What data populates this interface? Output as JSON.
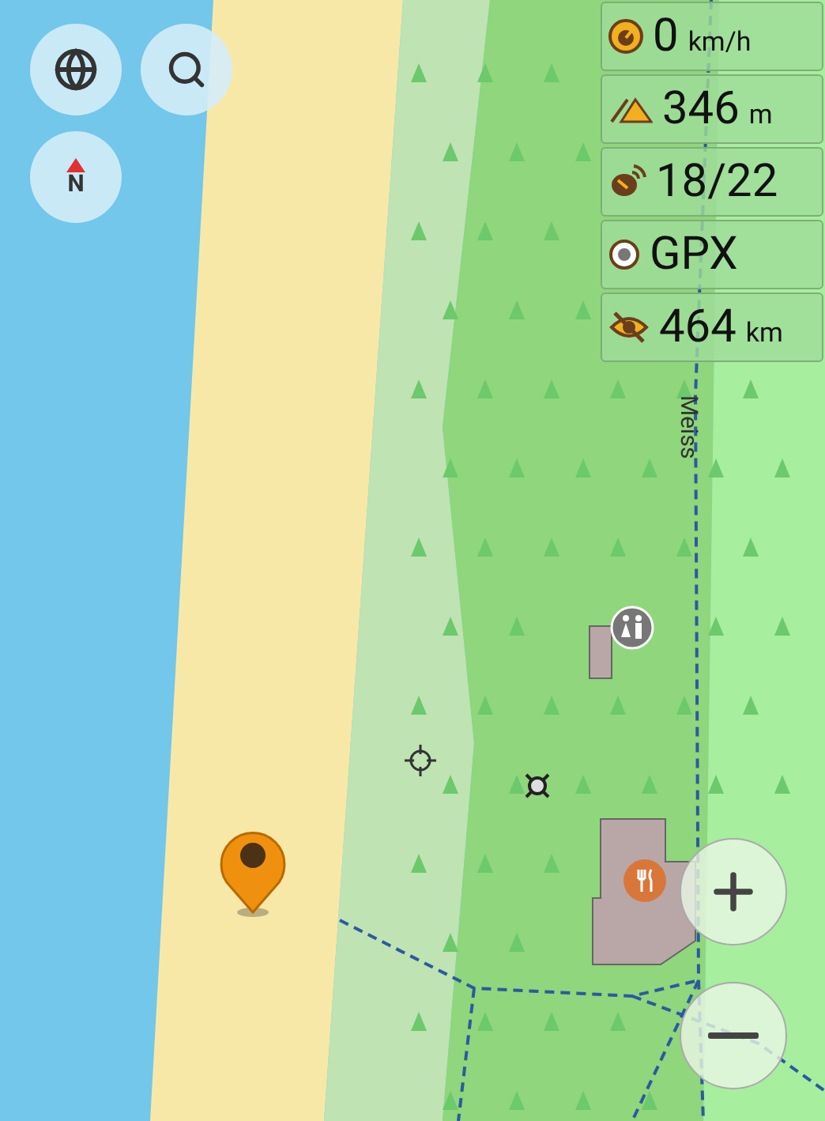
{
  "map": {
    "road_label": "Meiss"
  },
  "widgets": [
    {
      "kind": "speed",
      "value": "0",
      "unit": "km/h"
    },
    {
      "kind": "altitude",
      "value": "346",
      "unit": "m"
    },
    {
      "kind": "satellites",
      "value": "18/22"
    },
    {
      "kind": "gpx",
      "value": "GPX"
    },
    {
      "kind": "distance",
      "value": "464",
      "unit": "km"
    }
  ],
  "compass": {
    "label": "N"
  }
}
